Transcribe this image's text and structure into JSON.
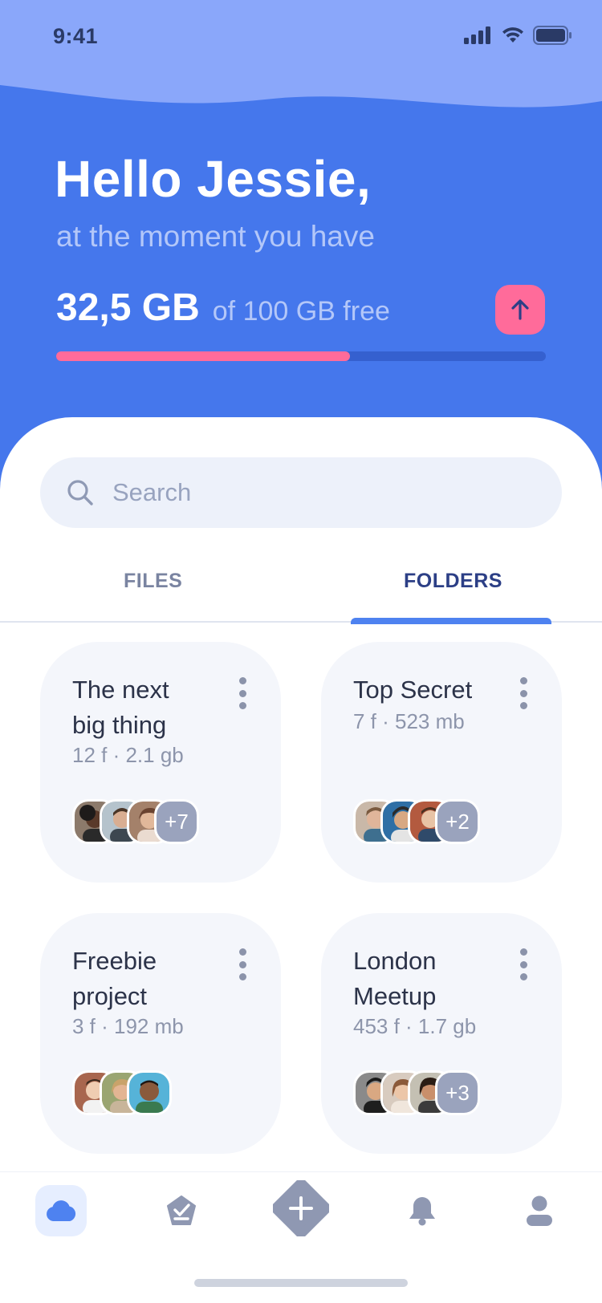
{
  "status_bar": {
    "time": "9:41",
    "icons": [
      "signal-icon",
      "wifi-icon",
      "battery-icon"
    ]
  },
  "header": {
    "greeting": "Hello Jessie,",
    "subtitle": "at the moment you have",
    "storage_used": "32,5 GB",
    "storage_total": "of 100 GB free",
    "progress_fraction": 0.6,
    "upload_icon": "arrow-up-icon"
  },
  "search": {
    "placeholder": "Search",
    "icon": "search-icon"
  },
  "tabs": [
    {
      "label": "FILES",
      "active": false
    },
    {
      "label": "FOLDERS",
      "active": true
    }
  ],
  "folders": [
    {
      "title_line1": "The next",
      "title_line2": "big thing",
      "meta": "12 f · 2.1 gb",
      "more": "+7"
    },
    {
      "title_line1": "Top Secret",
      "title_line2": "",
      "meta": "7 f · 523 mb",
      "more": "+2"
    },
    {
      "title_line1": "Freebie",
      "title_line2": "project",
      "meta": "3 f · 192 mb",
      "more": ""
    },
    {
      "title_line1": "London",
      "title_line2": "Meetup",
      "meta": "453 f · 1.7 gb",
      "more": "+3"
    }
  ],
  "bottom_nav": [
    {
      "name": "cloud-icon",
      "active": true
    },
    {
      "name": "checklist-icon",
      "active": false
    },
    {
      "name": "plus-icon",
      "active": false
    },
    {
      "name": "bell-icon",
      "active": false
    },
    {
      "name": "user-icon",
      "active": false
    }
  ],
  "colors": {
    "header_blue": "#4577ec",
    "accent_pink": "#ff6b9a",
    "active_tab": "#2c3f86",
    "card_bg": "#f4f6fb"
  }
}
